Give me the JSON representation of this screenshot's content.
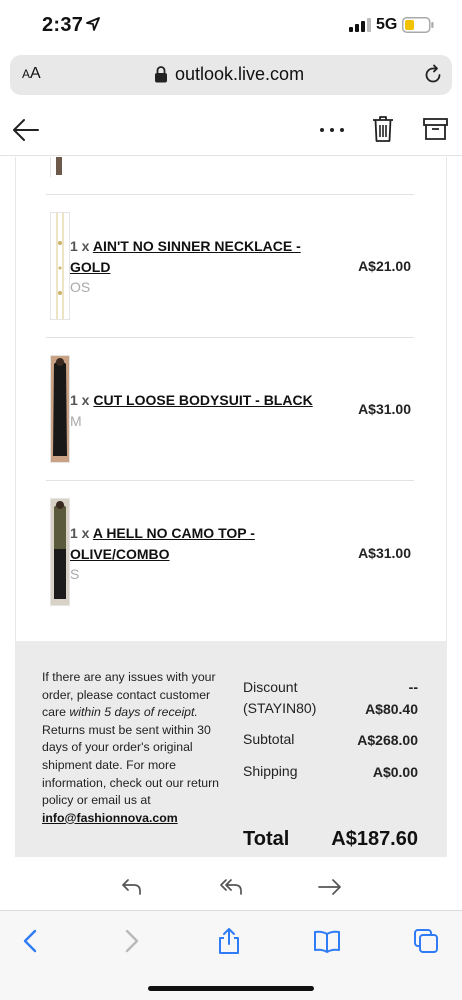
{
  "status_bar": {
    "time": "2:37",
    "network": "5G"
  },
  "url_bar": {
    "aa_small": "A",
    "aa_large": "A",
    "url": "outlook.live.com"
  },
  "order": {
    "items": [
      {
        "qty": "1 x",
        "name_line1": "AIN'T NO SINNER NECKLACE -",
        "name_line2": "GOLD",
        "variant": "OS",
        "price": "A$21.00"
      },
      {
        "qty": "1 x",
        "name_line1": "CUT LOOSE BODYSUIT - BLACK",
        "name_line2": "",
        "variant": "M",
        "price": "A$31.00"
      },
      {
        "qty": "1 x",
        "name_line1": "A HELL NO CAMO TOP -",
        "name_line2": "OLIVE/COMBO",
        "variant": "S",
        "price": "A$31.00"
      }
    ]
  },
  "summary": {
    "policy": {
      "part1": "If there are any issues with your order, please contact customer care ",
      "italic": "within 5 days of receipt.",
      "part2": " Returns must be sent within 30 days of your order's original shipment date. For more information, check out our return policy or email us at ",
      "email": "info@fashionnova.com"
    },
    "discount_label": "Discount",
    "discount_code": "(STAYIN80)",
    "discount_dash": "--",
    "discount_value": "A$80.40",
    "subtotal_label": "Subtotal",
    "subtotal_value": "A$268.00",
    "shipping_label": "Shipping",
    "shipping_value": "A$0.00",
    "total_label": "Total",
    "total_value": "A$187.60"
  },
  "colors": {
    "ios_blue": "#2f7cf6",
    "summary_bg": "#ebebeb"
  }
}
